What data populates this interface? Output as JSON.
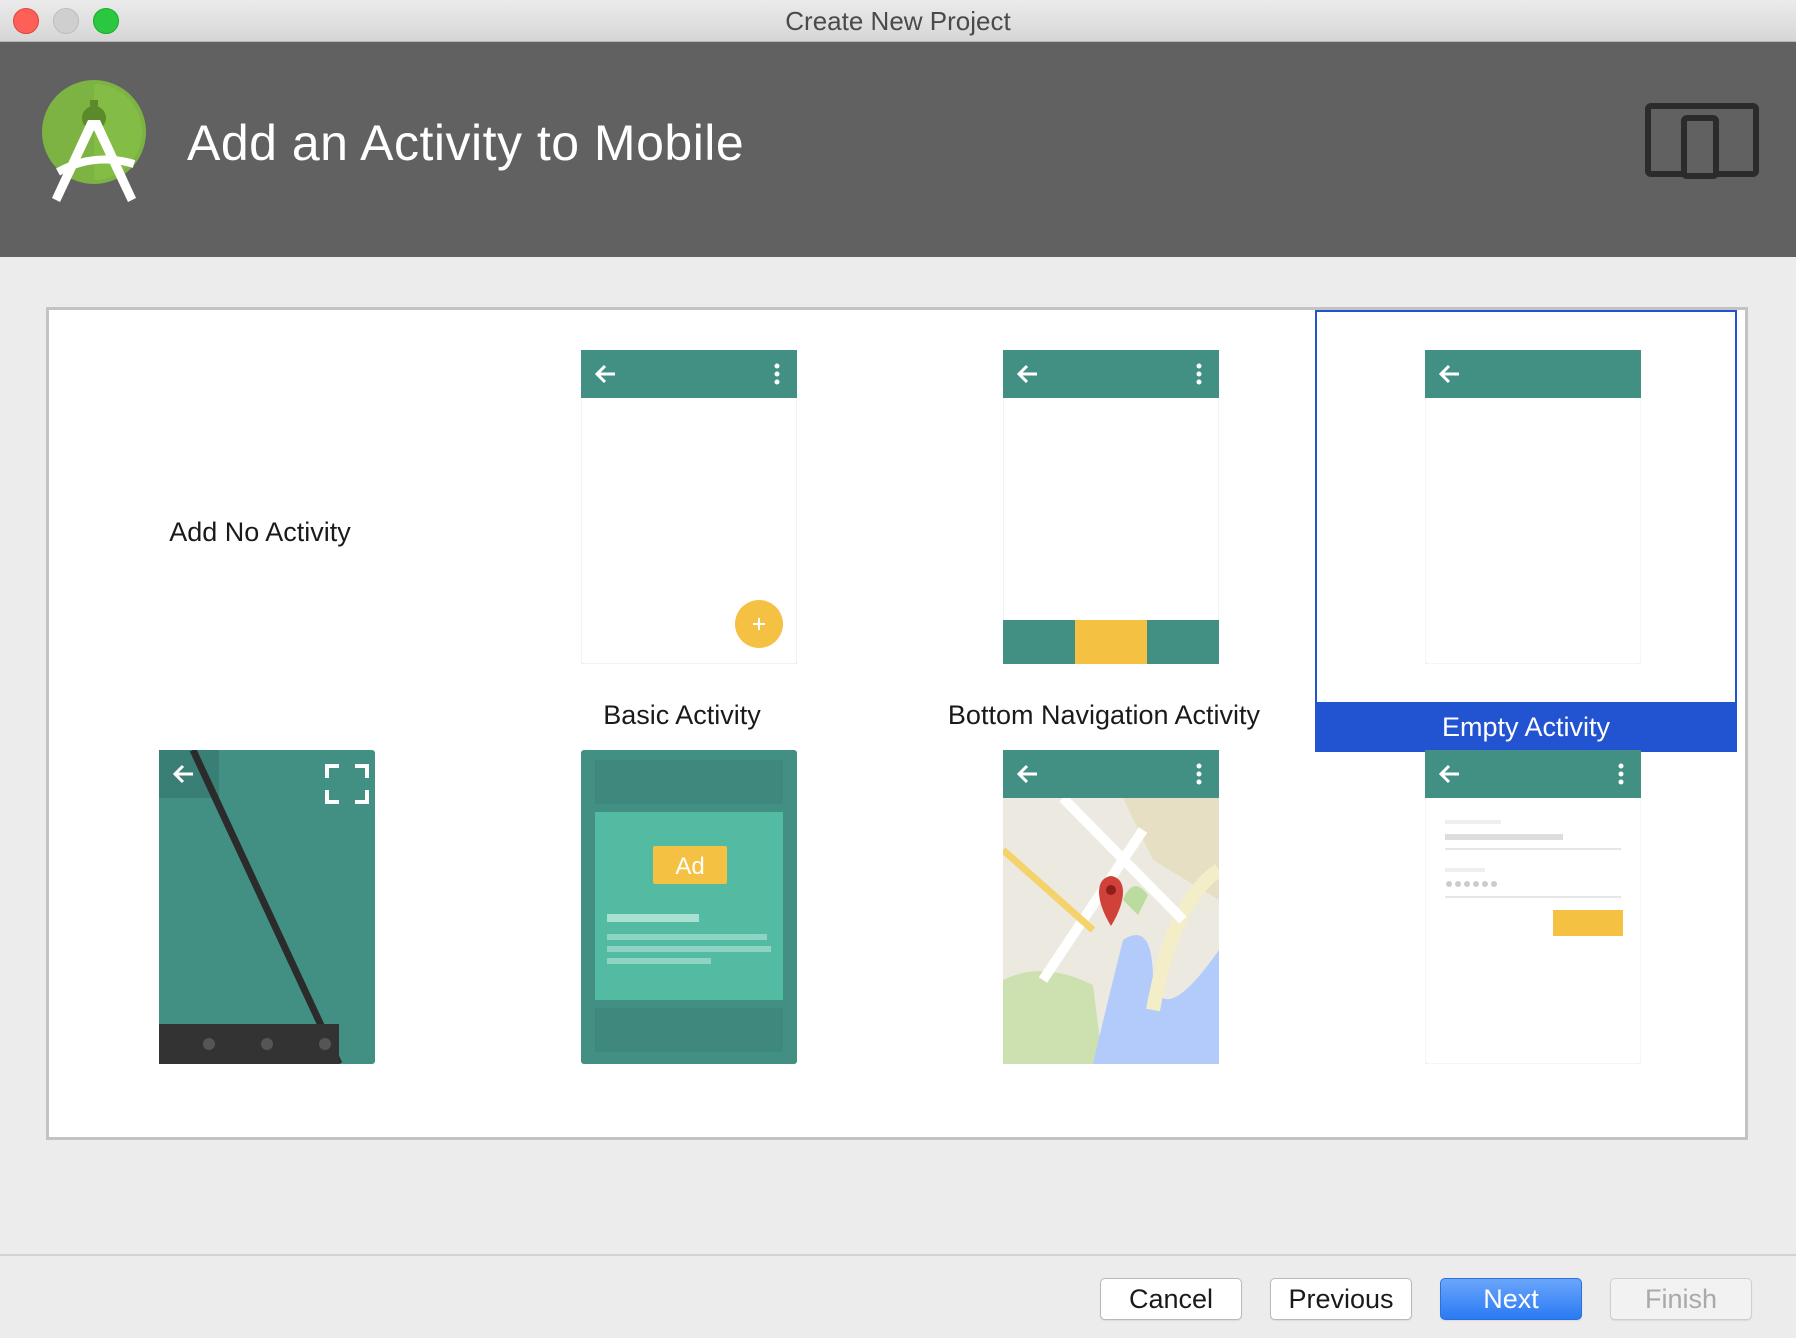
{
  "window": {
    "title": "Create New Project"
  },
  "header": {
    "title": "Add an Activity to Mobile"
  },
  "gallery": {
    "items": [
      {
        "label": "Add No Activity",
        "selected": false
      },
      {
        "label": "Basic Activity",
        "selected": false
      },
      {
        "label": "Bottom Navigation Activity",
        "selected": false
      },
      {
        "label": "Empty Activity",
        "selected": true
      },
      {
        "label": "",
        "selected": false
      },
      {
        "label": "",
        "selected": false
      },
      {
        "label": "",
        "selected": false
      },
      {
        "label": "",
        "selected": false
      }
    ],
    "ad_badge": "Ad"
  },
  "footer": {
    "cancel": "Cancel",
    "previous": "Previous",
    "next": "Next",
    "finish": "Finish"
  },
  "colors": {
    "accent": "#2253d0",
    "header_bg": "#616161",
    "teal": "#428f84",
    "teal_light": "#54bba3",
    "yellow": "#f4c142"
  }
}
